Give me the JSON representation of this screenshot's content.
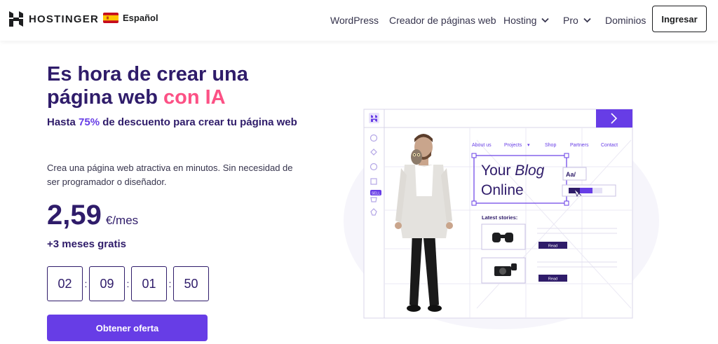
{
  "header": {
    "brand": "HOSTINGER",
    "language": "Español",
    "nav": [
      {
        "label": "WordPress",
        "dropdown": false
      },
      {
        "label": "Creador de páginas web",
        "dropdown": false
      },
      {
        "label": "Hosting",
        "dropdown": true
      },
      {
        "label": "Pro",
        "dropdown": true
      },
      {
        "label": "Dominios",
        "dropdown": false
      }
    ],
    "login_label": "Ingresar"
  },
  "hero": {
    "title_part1": "Es hora de crear una página web ",
    "title_accent": "con IA",
    "subtitle_prefix": "Hasta ",
    "subtitle_pct": "75%",
    "subtitle_suffix": " de descuento para crear tu página web",
    "description": "Crea una página web atractiva en minutos. Sin necesidad de ser programador o diseñador.",
    "price_amount": "2,59",
    "price_unit": "€/mes",
    "bonus": "+3 meses gratis",
    "countdown": [
      "02",
      "09",
      "01",
      "50"
    ],
    "countdown_separator": ":",
    "cta_label": "Obtener oferta"
  },
  "mockup": {
    "nav": [
      "About us",
      "Projects",
      "Shop",
      "Partners",
      "Contact"
    ],
    "projects_caret": "▾",
    "headline_part1": "Your ",
    "headline_italic": "Blog",
    "headline_line2": "Online",
    "font_chip": "Aa/",
    "latest_label": "Latest stories:",
    "read_label": "Read",
    "sell_badge": "SELL"
  },
  "colors": {
    "brand_dark": "#2f1c6a",
    "brand_purple": "#673de6",
    "accent_pink": "#fc5185"
  }
}
